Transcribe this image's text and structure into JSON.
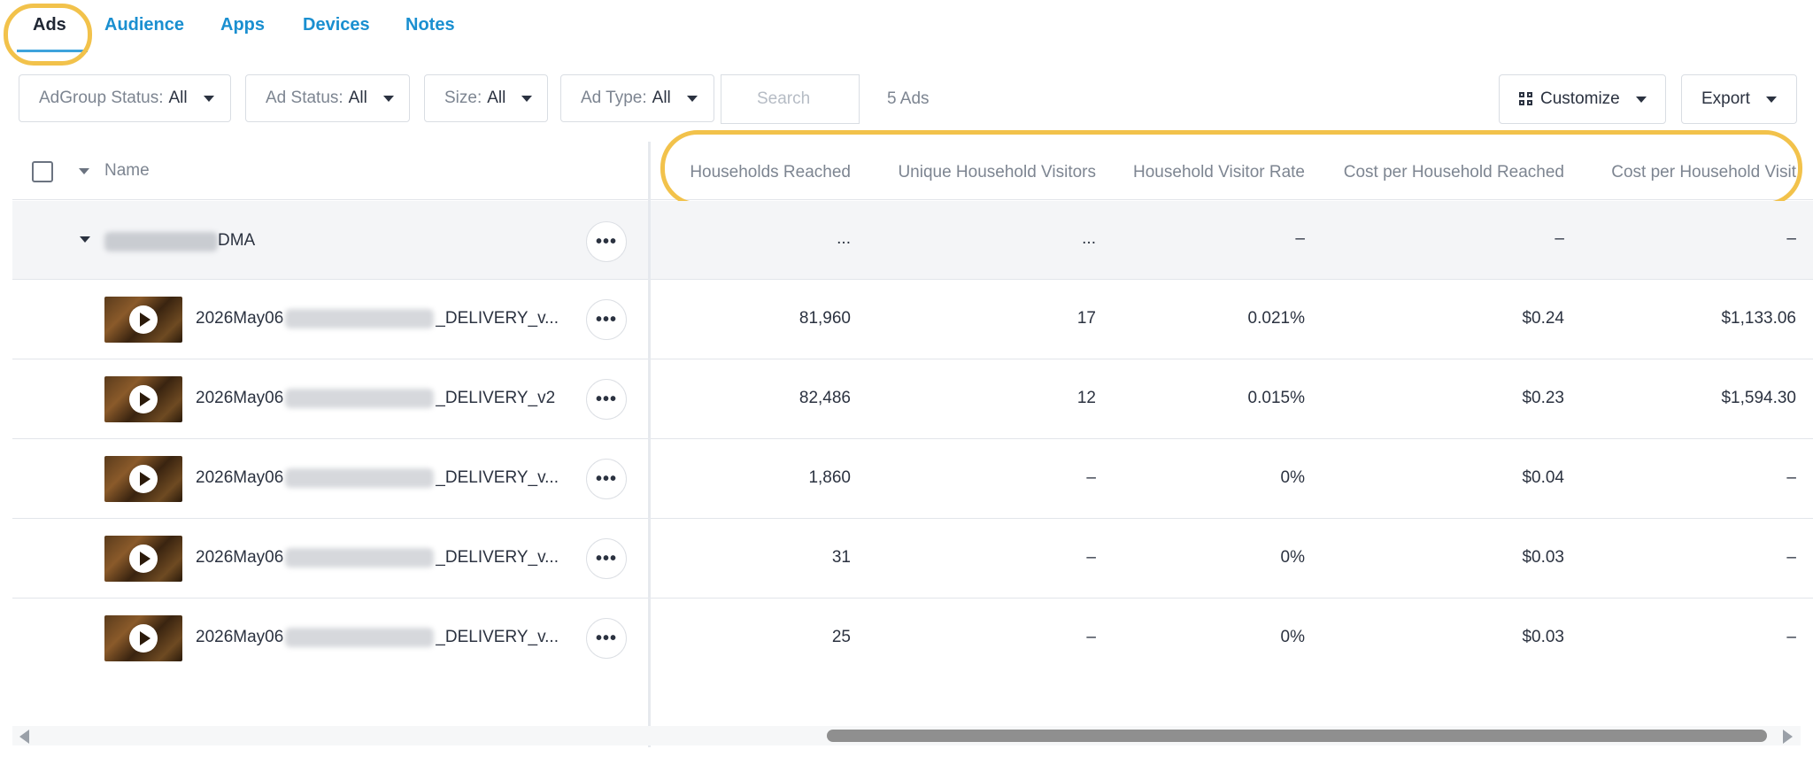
{
  "tabs": [
    {
      "label": "Ads",
      "active": true
    },
    {
      "label": "Audience"
    },
    {
      "label": "Apps"
    },
    {
      "label": "Devices"
    },
    {
      "label": "Notes"
    }
  ],
  "filters": {
    "adgroup_status": {
      "label": "AdGroup Status:",
      "value": "All"
    },
    "ad_status": {
      "label": "Ad Status:",
      "value": "All"
    },
    "size": {
      "label": "Size:",
      "value": "All"
    },
    "ad_type": {
      "label": "Ad Type:",
      "value": "All"
    },
    "search_placeholder": "Search",
    "count": "5 Ads"
  },
  "actions": {
    "customize": "Customize",
    "export": "Export"
  },
  "table": {
    "columns": [
      "Name",
      "Households Reached",
      "Unique Household Visitors",
      "Household Visitor Rate",
      "Cost per Household Reached",
      "Cost per Household Visit"
    ],
    "group": {
      "label": "DMA",
      "values": [
        "...",
        "...",
        "–",
        "–",
        "–"
      ]
    },
    "rows": [
      {
        "prefix": "2026May06",
        "suffix": "_DELIVERY_v...",
        "values": [
          "81,960",
          "17",
          "0.021%",
          "$0.24",
          "$1,133.06"
        ]
      },
      {
        "prefix": "2026May06",
        "suffix": "_DELIVERY_v2",
        "values": [
          "82,486",
          "12",
          "0.015%",
          "$0.23",
          "$1,594.30"
        ]
      },
      {
        "prefix": "2026May06",
        "suffix": "_DELIVERY_v...",
        "values": [
          "1,860",
          "–",
          "0%",
          "$0.04",
          "–"
        ]
      },
      {
        "prefix": "2026May06",
        "suffix": "_DELIVERY_v...",
        "values": [
          "31",
          "–",
          "0%",
          "$0.03",
          "–"
        ]
      },
      {
        "prefix": "2026May06",
        "suffix": "_DELIVERY_v...",
        "values": [
          "25",
          "–",
          "0%",
          "$0.03",
          "–"
        ]
      }
    ]
  },
  "colors": {
    "highlight": "#f2c24b",
    "tab_link": "#1a8fd0",
    "scroll_thumb": "#8f8f8f"
  },
  "icons": [
    "caret-down-icon",
    "grid-icon",
    "more-icon",
    "play-icon",
    "arrow-left-icon",
    "arrow-right-icon"
  ]
}
